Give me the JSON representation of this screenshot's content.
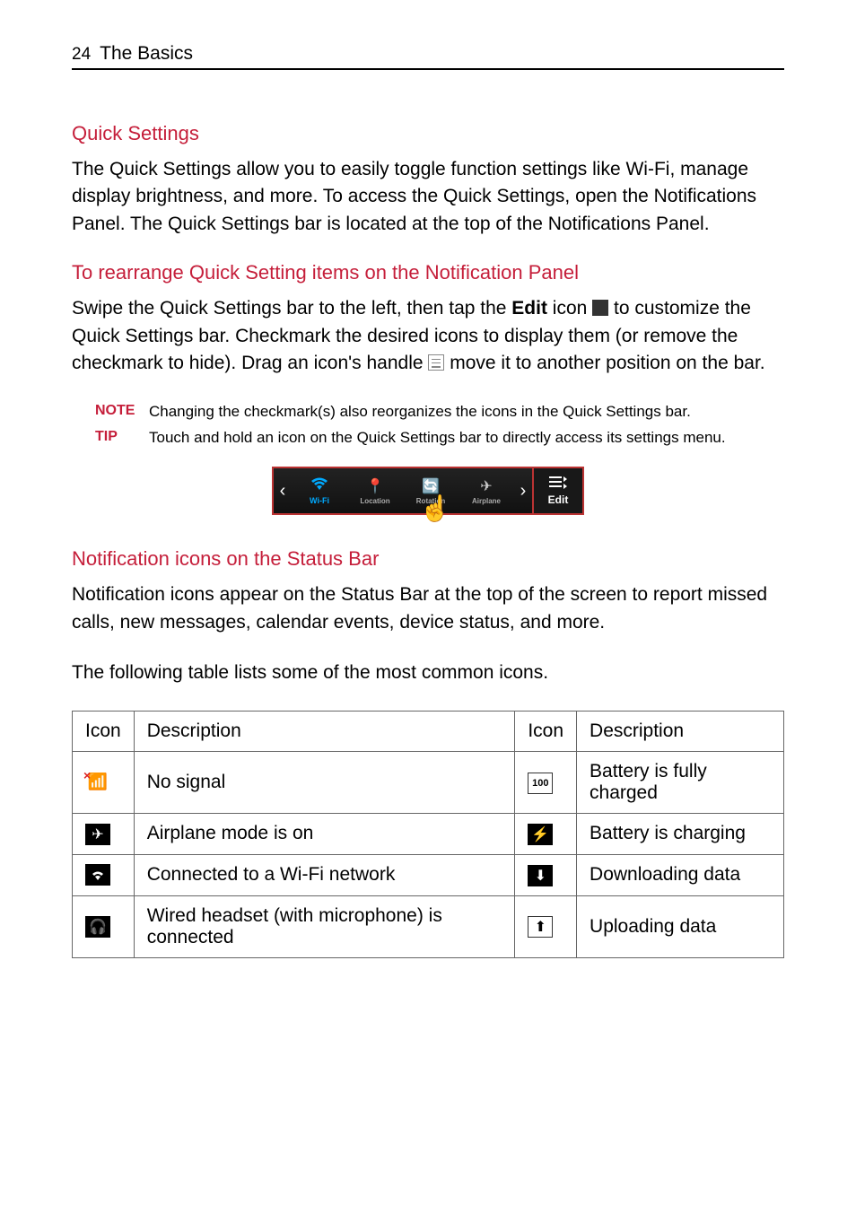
{
  "header": {
    "page_number": "24",
    "section": "The Basics"
  },
  "sections": {
    "quick_settings": {
      "heading": "Quick Settings",
      "body": "The Quick Settings allow you to easily toggle function settings like Wi-Fi, manage display brightness, and more. To access the Quick Settings, open the Notifications Panel. The Quick Settings bar is located at the top of the Notifications Panel."
    },
    "rearrange": {
      "heading": "To rearrange Quick Setting items on the Notification Panel",
      "body_part1": "Swipe the Quick Settings bar to the left, then tap the ",
      "edit_word": "Edit",
      "body_part2": " icon ",
      "body_part3": " to customize the Quick Settings bar. Checkmark the desired icons to display them (or remove the checkmark to hide). Drag an icon's handle ",
      "body_part4": " move it to another position on the bar.",
      "note_label": "NOTE",
      "note_text": "Changing the checkmark(s) also reorganizes the icons in the Quick Settings bar.",
      "tip_label": "TIP",
      "tip_text": "Touch and hold an icon on the Quick Settings bar to directly access its settings menu."
    },
    "qs_bar": {
      "wifi": "Wi-Fi",
      "location": "Location",
      "rotation": "Rotation",
      "airplane": "Airplane",
      "edit": "Edit"
    },
    "status_bar": {
      "heading": "Notification icons on the Status Bar",
      "body": "Notification icons appear on the Status Bar at the top of the screen to report missed calls, new messages, calendar events, device status, and more.",
      "body2": "The following table lists some of the most common icons."
    },
    "table": {
      "col_icon": "Icon",
      "col_desc": "Description",
      "rows": [
        {
          "left": "No signal",
          "right": "Battery is fully charged"
        },
        {
          "left": "Airplane mode is on",
          "right": "Battery is charging"
        },
        {
          "left": "Connected to a Wi-Fi network",
          "right": "Downloading data"
        },
        {
          "left": "Wired headset (with microphone) is connected",
          "right": "Uploading data"
        }
      ]
    }
  }
}
